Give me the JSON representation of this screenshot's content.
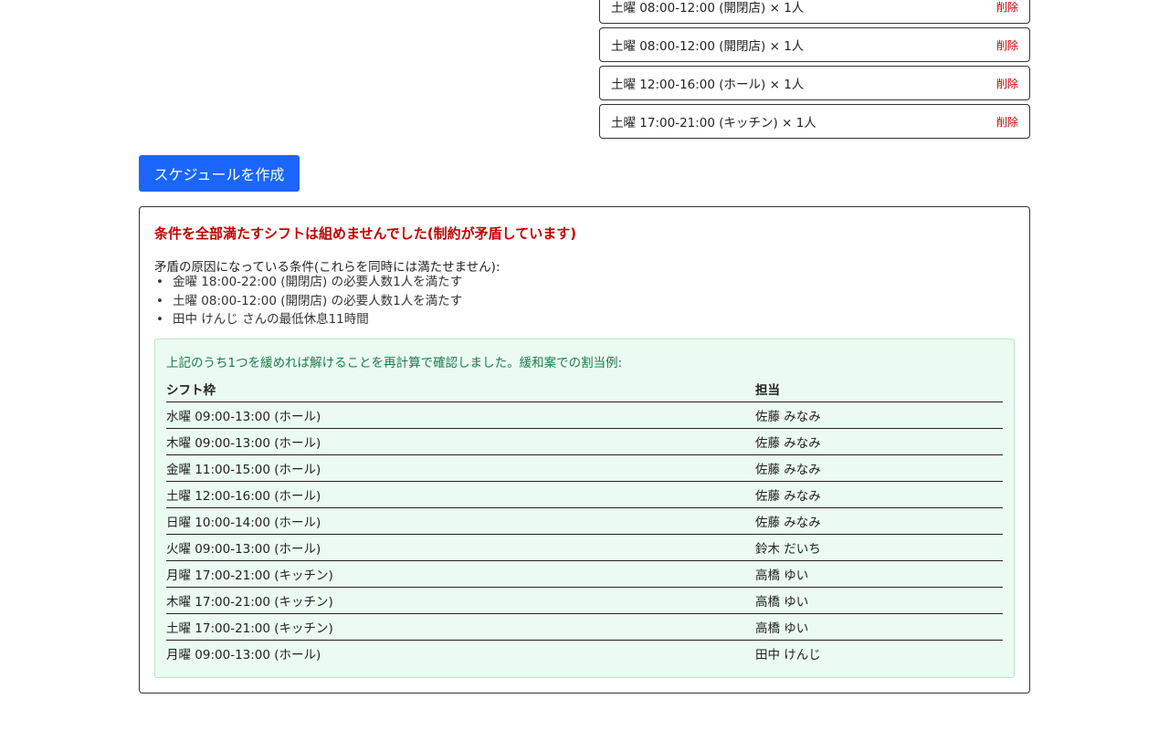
{
  "slots": [
    {
      "label": "土曜 08:00-12:00 (開閉店) × 1人",
      "delete_label": "削除"
    },
    {
      "label": "土曜 08:00-12:00 (開閉店) × 1人",
      "delete_label": "削除"
    },
    {
      "label": "土曜 12:00-16:00 (ホール) × 1人",
      "delete_label": "削除"
    },
    {
      "label": "土曜 17:00-21:00 (キッチン) × 1人",
      "delete_label": "削除"
    }
  ],
  "create_button": "スケジュールを作成",
  "result": {
    "error_title": "条件を全部満たすシフトは組めませんでした(制約が矛盾しています)",
    "conflict_intro": "矛盾の原因になっている条件(これらを同時には満たせません):",
    "conflicts": [
      "金曜 18:00-22:00 (開閉店) の必要人数1人を満たす",
      "土曜 08:00-12:00 (開閉店) の必要人数1人を満たす",
      "田中 けんじ さんの最低休息11時間"
    ],
    "relax": {
      "note": "上記のうち1つを緩めれば解けることを再計算で確認しました。緩和案での割当例:",
      "headers": {
        "slot": "シフト枠",
        "assignee": "担当"
      },
      "rows": [
        {
          "slot": "水曜 09:00-13:00 (ホール)",
          "assignee": "佐藤 みなみ"
        },
        {
          "slot": "木曜 09:00-13:00 (ホール)",
          "assignee": "佐藤 みなみ"
        },
        {
          "slot": "金曜 11:00-15:00 (ホール)",
          "assignee": "佐藤 みなみ"
        },
        {
          "slot": "土曜 12:00-16:00 (ホール)",
          "assignee": "佐藤 みなみ"
        },
        {
          "slot": "日曜 10:00-14:00 (ホール)",
          "assignee": "佐藤 みなみ"
        },
        {
          "slot": "火曜 09:00-13:00 (ホール)",
          "assignee": "鈴木 だいち"
        },
        {
          "slot": "月曜 17:00-21:00 (キッチン)",
          "assignee": "高橋 ゆい"
        },
        {
          "slot": "木曜 17:00-21:00 (キッチン)",
          "assignee": "高橋 ゆい"
        },
        {
          "slot": "土曜 17:00-21:00 (キッチン)",
          "assignee": "高橋 ゆい"
        },
        {
          "slot": "月曜 09:00-13:00 (ホール)",
          "assignee": "田中 けんじ"
        }
      ]
    }
  }
}
